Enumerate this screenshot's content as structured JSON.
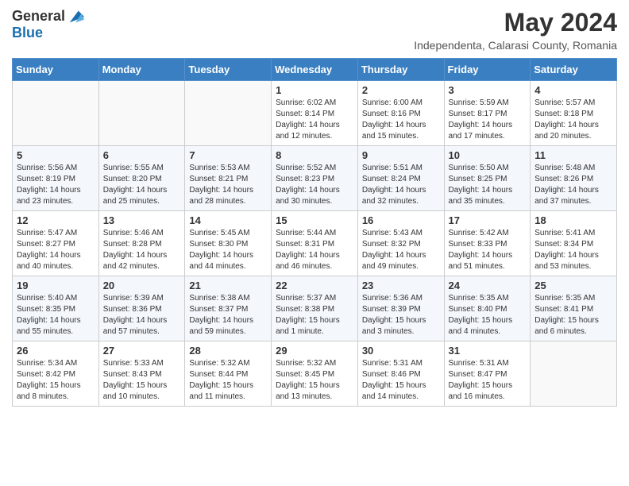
{
  "header": {
    "logo_general": "General",
    "logo_blue": "Blue",
    "month_title": "May 2024",
    "location": "Independenta, Calarasi County, Romania"
  },
  "days_of_week": [
    "Sunday",
    "Monday",
    "Tuesday",
    "Wednesday",
    "Thursday",
    "Friday",
    "Saturday"
  ],
  "weeks": [
    [
      {
        "day": "",
        "text": ""
      },
      {
        "day": "",
        "text": ""
      },
      {
        "day": "",
        "text": ""
      },
      {
        "day": "1",
        "text": "Sunrise: 6:02 AM\nSunset: 8:14 PM\nDaylight: 14 hours and 12 minutes."
      },
      {
        "day": "2",
        "text": "Sunrise: 6:00 AM\nSunset: 8:16 PM\nDaylight: 14 hours and 15 minutes."
      },
      {
        "day": "3",
        "text": "Sunrise: 5:59 AM\nSunset: 8:17 PM\nDaylight: 14 hours and 17 minutes."
      },
      {
        "day": "4",
        "text": "Sunrise: 5:57 AM\nSunset: 8:18 PM\nDaylight: 14 hours and 20 minutes."
      }
    ],
    [
      {
        "day": "5",
        "text": "Sunrise: 5:56 AM\nSunset: 8:19 PM\nDaylight: 14 hours and 23 minutes."
      },
      {
        "day": "6",
        "text": "Sunrise: 5:55 AM\nSunset: 8:20 PM\nDaylight: 14 hours and 25 minutes."
      },
      {
        "day": "7",
        "text": "Sunrise: 5:53 AM\nSunset: 8:21 PM\nDaylight: 14 hours and 28 minutes."
      },
      {
        "day": "8",
        "text": "Sunrise: 5:52 AM\nSunset: 8:23 PM\nDaylight: 14 hours and 30 minutes."
      },
      {
        "day": "9",
        "text": "Sunrise: 5:51 AM\nSunset: 8:24 PM\nDaylight: 14 hours and 32 minutes."
      },
      {
        "day": "10",
        "text": "Sunrise: 5:50 AM\nSunset: 8:25 PM\nDaylight: 14 hours and 35 minutes."
      },
      {
        "day": "11",
        "text": "Sunrise: 5:48 AM\nSunset: 8:26 PM\nDaylight: 14 hours and 37 minutes."
      }
    ],
    [
      {
        "day": "12",
        "text": "Sunrise: 5:47 AM\nSunset: 8:27 PM\nDaylight: 14 hours and 40 minutes."
      },
      {
        "day": "13",
        "text": "Sunrise: 5:46 AM\nSunset: 8:28 PM\nDaylight: 14 hours and 42 minutes."
      },
      {
        "day": "14",
        "text": "Sunrise: 5:45 AM\nSunset: 8:30 PM\nDaylight: 14 hours and 44 minutes."
      },
      {
        "day": "15",
        "text": "Sunrise: 5:44 AM\nSunset: 8:31 PM\nDaylight: 14 hours and 46 minutes."
      },
      {
        "day": "16",
        "text": "Sunrise: 5:43 AM\nSunset: 8:32 PM\nDaylight: 14 hours and 49 minutes."
      },
      {
        "day": "17",
        "text": "Sunrise: 5:42 AM\nSunset: 8:33 PM\nDaylight: 14 hours and 51 minutes."
      },
      {
        "day": "18",
        "text": "Sunrise: 5:41 AM\nSunset: 8:34 PM\nDaylight: 14 hours and 53 minutes."
      }
    ],
    [
      {
        "day": "19",
        "text": "Sunrise: 5:40 AM\nSunset: 8:35 PM\nDaylight: 14 hours and 55 minutes."
      },
      {
        "day": "20",
        "text": "Sunrise: 5:39 AM\nSunset: 8:36 PM\nDaylight: 14 hours and 57 minutes."
      },
      {
        "day": "21",
        "text": "Sunrise: 5:38 AM\nSunset: 8:37 PM\nDaylight: 14 hours and 59 minutes."
      },
      {
        "day": "22",
        "text": "Sunrise: 5:37 AM\nSunset: 8:38 PM\nDaylight: 15 hours and 1 minute."
      },
      {
        "day": "23",
        "text": "Sunrise: 5:36 AM\nSunset: 8:39 PM\nDaylight: 15 hours and 3 minutes."
      },
      {
        "day": "24",
        "text": "Sunrise: 5:35 AM\nSunset: 8:40 PM\nDaylight: 15 hours and 4 minutes."
      },
      {
        "day": "25",
        "text": "Sunrise: 5:35 AM\nSunset: 8:41 PM\nDaylight: 15 hours and 6 minutes."
      }
    ],
    [
      {
        "day": "26",
        "text": "Sunrise: 5:34 AM\nSunset: 8:42 PM\nDaylight: 15 hours and 8 minutes."
      },
      {
        "day": "27",
        "text": "Sunrise: 5:33 AM\nSunset: 8:43 PM\nDaylight: 15 hours and 10 minutes."
      },
      {
        "day": "28",
        "text": "Sunrise: 5:32 AM\nSunset: 8:44 PM\nDaylight: 15 hours and 11 minutes."
      },
      {
        "day": "29",
        "text": "Sunrise: 5:32 AM\nSunset: 8:45 PM\nDaylight: 15 hours and 13 minutes."
      },
      {
        "day": "30",
        "text": "Sunrise: 5:31 AM\nSunset: 8:46 PM\nDaylight: 15 hours and 14 minutes."
      },
      {
        "day": "31",
        "text": "Sunrise: 5:31 AM\nSunset: 8:47 PM\nDaylight: 15 hours and 16 minutes."
      },
      {
        "day": "",
        "text": ""
      }
    ]
  ]
}
